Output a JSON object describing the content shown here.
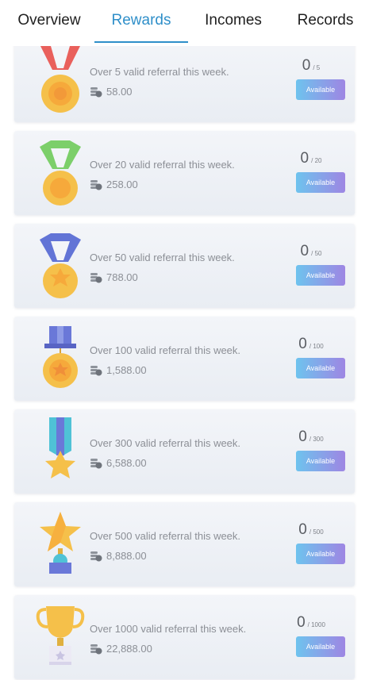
{
  "tabs": [
    {
      "label": "Overview"
    },
    {
      "label": "Rewards",
      "active": true
    },
    {
      "label": "Incomes"
    },
    {
      "label": "Records"
    }
  ],
  "colors": {
    "accent": "#2f8fc9",
    "button_from": "#6ec3ee",
    "button_to": "#9e86e3"
  },
  "rewards": [
    {
      "medal": "red-ribbon-medal-icon",
      "description": "Over 5 valid referral this week.",
      "amount": "58.00",
      "progress": "0",
      "target": "5",
      "button": "Available"
    },
    {
      "medal": "green-ribbon-medal-icon",
      "description": "Over 20 valid referral this week.",
      "amount": "258.00",
      "progress": "0",
      "target": "20",
      "button": "Available"
    },
    {
      "medal": "blue-ribbon-medal-icon",
      "description": "Over 50 valid referral this week.",
      "amount": "788.00",
      "progress": "0",
      "target": "50",
      "button": "Available"
    },
    {
      "medal": "star-medal-icon",
      "description": "Over 100 valid referral this week.",
      "amount": "1,588.00",
      "progress": "0",
      "target": "100",
      "button": "Available"
    },
    {
      "medal": "star-ribbon-icon",
      "description": "Over 300 valid referral this week.",
      "amount": "6,588.00",
      "progress": "0",
      "target": "300",
      "button": "Available"
    },
    {
      "medal": "star-trophy-icon",
      "description": "Over 500 valid referral this week.",
      "amount": "8,888.00",
      "progress": "0",
      "target": "500",
      "button": "Available"
    },
    {
      "medal": "gold-cup-trophy-icon",
      "description": "Over 1000 valid referral this week.",
      "amount": "22,888.00",
      "progress": "0",
      "target": "1000",
      "button": "Available"
    }
  ]
}
